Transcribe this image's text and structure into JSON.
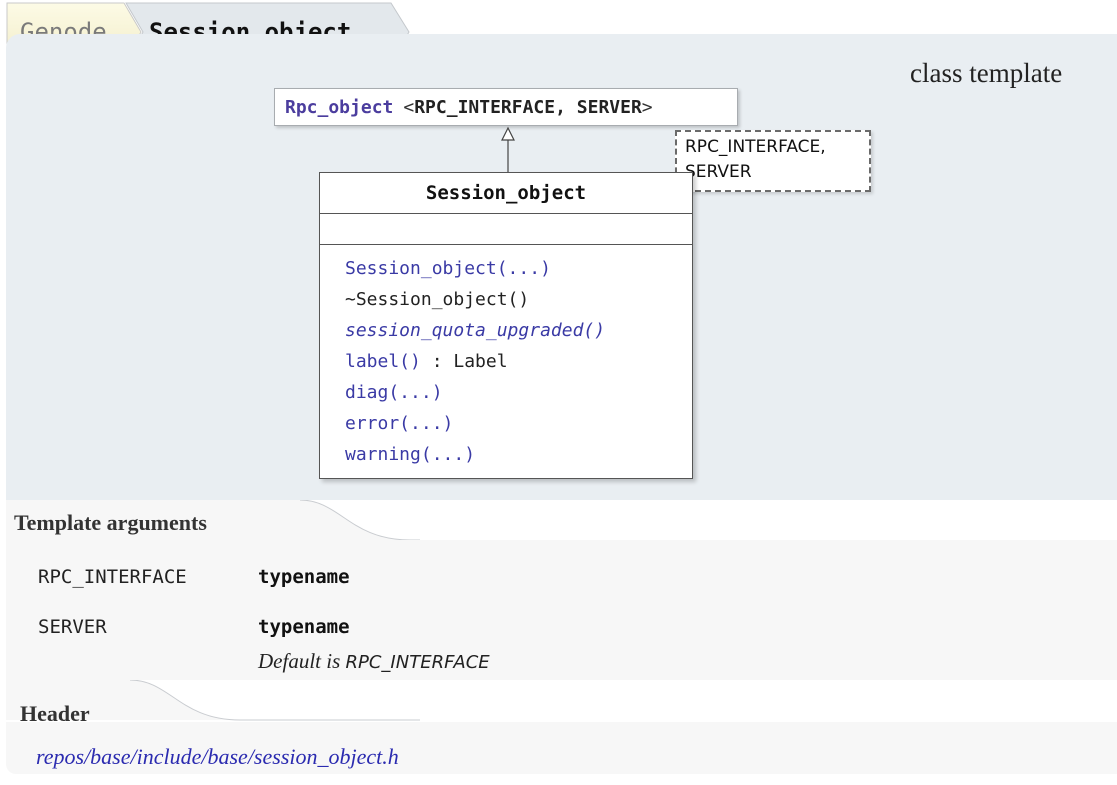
{
  "breadcrumb": {
    "items": [
      "Genode",
      "Session_object"
    ]
  },
  "class_kind": "class template",
  "diagram": {
    "parent": {
      "name": "Rpc_object",
      "args": "RPC_INTERFACE, SERVER",
      "open": "<",
      "close": ">"
    },
    "template_params_box": [
      "RPC_INTERFACE,",
      "SERVER"
    ],
    "class_name": "Session_object",
    "methods": [
      {
        "name": "Session_object(...)",
        "suffix": "",
        "style": "link"
      },
      {
        "name": "~Session_object()",
        "suffix": "",
        "style": "plain"
      },
      {
        "name": "session_quota_upgraded()",
        "suffix": "",
        "style": "link-italic"
      },
      {
        "name": "label()",
        "suffix": " : Label",
        "style": "link"
      },
      {
        "name": "diag(...)",
        "suffix": "",
        "style": "link"
      },
      {
        "name": "error(...)",
        "suffix": "",
        "style": "link"
      },
      {
        "name": "warning(...)",
        "suffix": "",
        "style": "link"
      }
    ]
  },
  "sections": {
    "template_args": {
      "title": "Template arguments",
      "args": [
        {
          "name": "RPC_INTERFACE",
          "type": "typename",
          "default_prefix": "",
          "default_value": ""
        },
        {
          "name": "SERVER",
          "type": "typename",
          "default_prefix": "Default is ",
          "default_value": "RPC_INTERFACE"
        }
      ]
    },
    "header": {
      "title": "Header",
      "path": "repos/base/include/base/session_object.h"
    }
  },
  "colors": {
    "panel_bg": "#e9eef2",
    "link": "#3a3aa5",
    "parent_link": "#4b3d9e"
  }
}
